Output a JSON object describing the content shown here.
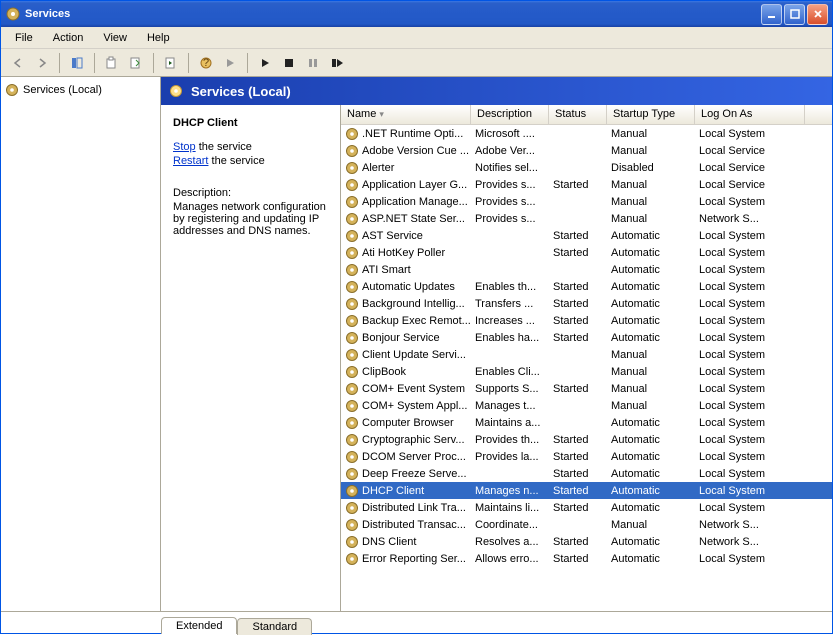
{
  "window": {
    "title": "Services"
  },
  "menu": [
    "File",
    "Action",
    "View",
    "Help"
  ],
  "left": {
    "root": "Services (Local)"
  },
  "header": {
    "title": "Services (Local)"
  },
  "detail": {
    "title": "DHCP Client",
    "stop_label": "Stop",
    "stop_suffix": " the service",
    "restart_label": "Restart",
    "restart_suffix": " the service",
    "desc_label": "Description:",
    "desc_text": "Manages network configuration by registering and updating IP addresses and DNS names."
  },
  "columns": {
    "name": "Name",
    "description": "Description",
    "status": "Status",
    "startup": "Startup Type",
    "logon": "Log On As"
  },
  "tabs": {
    "extended": "Extended",
    "standard": "Standard"
  },
  "selected_index": 19,
  "services": [
    {
      "name": ".NET Runtime Opti...",
      "desc": "Microsoft ....",
      "status": "",
      "startup": "Manual",
      "logon": "Local System"
    },
    {
      "name": "Adobe Version Cue ...",
      "desc": "Adobe Ver...",
      "status": "",
      "startup": "Manual",
      "logon": "Local Service"
    },
    {
      "name": "Alerter",
      "desc": "Notifies sel...",
      "status": "",
      "startup": "Disabled",
      "logon": "Local Service"
    },
    {
      "name": "Application Layer G...",
      "desc": "Provides s...",
      "status": "Started",
      "startup": "Manual",
      "logon": "Local Service"
    },
    {
      "name": "Application Manage...",
      "desc": "Provides s...",
      "status": "",
      "startup": "Manual",
      "logon": "Local System"
    },
    {
      "name": "ASP.NET State Ser...",
      "desc": "Provides s...",
      "status": "",
      "startup": "Manual",
      "logon": "Network S..."
    },
    {
      "name": "AST Service",
      "desc": "",
      "status": "Started",
      "startup": "Automatic",
      "logon": "Local System"
    },
    {
      "name": "Ati HotKey Poller",
      "desc": "",
      "status": "Started",
      "startup": "Automatic",
      "logon": "Local System"
    },
    {
      "name": "ATI Smart",
      "desc": "",
      "status": "",
      "startup": "Automatic",
      "logon": "Local System"
    },
    {
      "name": "Automatic Updates",
      "desc": "Enables th...",
      "status": "Started",
      "startup": "Automatic",
      "logon": "Local System"
    },
    {
      "name": "Background Intellig...",
      "desc": "Transfers ...",
      "status": "Started",
      "startup": "Automatic",
      "logon": "Local System"
    },
    {
      "name": "Backup Exec Remot...",
      "desc": "Increases ...",
      "status": "Started",
      "startup": "Automatic",
      "logon": "Local System"
    },
    {
      "name": "Bonjour Service",
      "desc": "Enables ha...",
      "status": "Started",
      "startup": "Automatic",
      "logon": "Local System"
    },
    {
      "name": "Client Update Servi...",
      "desc": "",
      "status": "",
      "startup": "Manual",
      "logon": "Local System"
    },
    {
      "name": "ClipBook",
      "desc": "Enables Cli...",
      "status": "",
      "startup": "Manual",
      "logon": "Local System"
    },
    {
      "name": "COM+ Event System",
      "desc": "Supports S...",
      "status": "Started",
      "startup": "Manual",
      "logon": "Local System"
    },
    {
      "name": "COM+ System Appl...",
      "desc": "Manages t...",
      "status": "",
      "startup": "Manual",
      "logon": "Local System"
    },
    {
      "name": "Computer Browser",
      "desc": "Maintains a...",
      "status": "",
      "startup": "Automatic",
      "logon": "Local System"
    },
    {
      "name": "Cryptographic Serv...",
      "desc": "Provides th...",
      "status": "Started",
      "startup": "Automatic",
      "logon": "Local System"
    },
    {
      "name": "DCOM Server Proc...",
      "desc": "Provides la...",
      "status": "Started",
      "startup": "Automatic",
      "logon": "Local System"
    },
    {
      "name": "Deep Freeze Serve...",
      "desc": "",
      "status": "Started",
      "startup": "Automatic",
      "logon": "Local System"
    },
    {
      "name": "DHCP Client",
      "desc": "Manages n...",
      "status": "Started",
      "startup": "Automatic",
      "logon": "Local System"
    },
    {
      "name": "Distributed Link Tra...",
      "desc": "Maintains li...",
      "status": "Started",
      "startup": "Automatic",
      "logon": "Local System"
    },
    {
      "name": "Distributed Transac...",
      "desc": "Coordinate...",
      "status": "",
      "startup": "Manual",
      "logon": "Network S..."
    },
    {
      "name": "DNS Client",
      "desc": "Resolves a...",
      "status": "Started",
      "startup": "Automatic",
      "logon": "Network S..."
    },
    {
      "name": "Error Reporting Ser...",
      "desc": "Allows erro...",
      "status": "Started",
      "startup": "Automatic",
      "logon": "Local System"
    }
  ]
}
